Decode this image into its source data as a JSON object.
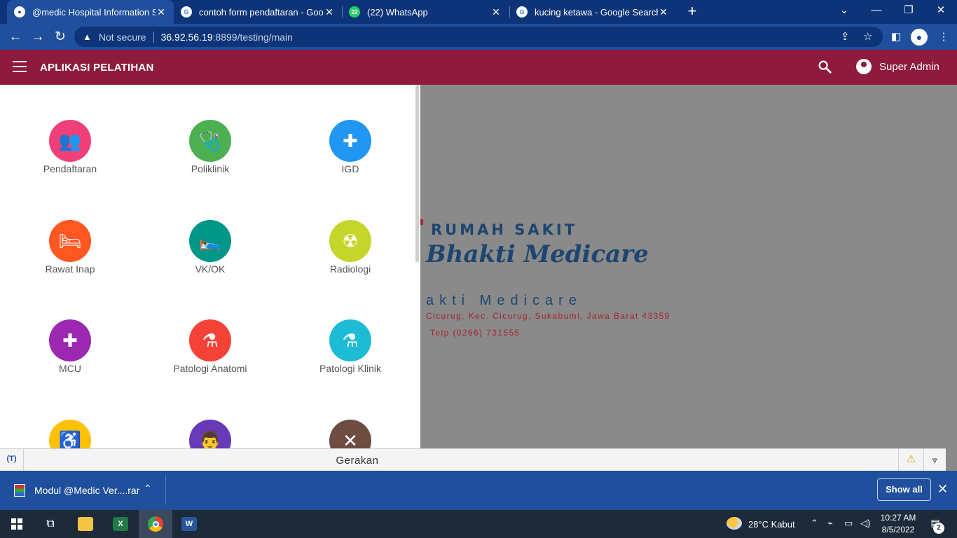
{
  "browser": {
    "tabs": [
      {
        "title": "@medic Hospital Information Sys",
        "favicon": "globe-icon",
        "active": true
      },
      {
        "title": "contoh form pendaftaran - Goog",
        "favicon": "google-icon",
        "active": false
      },
      {
        "title": "(22) WhatsApp",
        "favicon": "whatsapp-icon",
        "badge": "22",
        "active": false
      },
      {
        "title": "kucing ketawa - Google Search",
        "favicon": "google-icon",
        "active": false
      }
    ],
    "new_tab": "+",
    "window_controls": {
      "dropdown": "⌄",
      "minimize": "—",
      "restore": "❐",
      "close": "✕"
    },
    "address": {
      "security_label": "Not secure",
      "host": "36.92.56.19",
      "path": ":8899/testing/main"
    }
  },
  "app": {
    "title": "APLIKASI PELATIHAN",
    "user_name": "Super Admin",
    "accent_color": "#8e1a3e"
  },
  "menu": [
    {
      "label": "Pendaftaran",
      "color": "#f0407a",
      "icon": "person-add-icon",
      "glyph": "👥"
    },
    {
      "label": "Poliklinik",
      "color": "#4caf50",
      "icon": "stethoscope-icon",
      "glyph": "🩺"
    },
    {
      "label": "IGD",
      "color": "#2196f3",
      "icon": "medical-kit-icon",
      "glyph": "✚"
    },
    {
      "label": "Rawat Inap",
      "color": "#ff5722",
      "icon": "bed-icon",
      "glyph": "🛏"
    },
    {
      "label": "VK/OK",
      "color": "#009688",
      "icon": "patient-icon",
      "glyph": "🛌"
    },
    {
      "label": "Radiologi",
      "color": "#c6d52b",
      "icon": "radiation-icon",
      "glyph": "☢"
    },
    {
      "label": "MCU",
      "color": "#9c27b0",
      "icon": "briefcase-medical-icon",
      "glyph": "✚"
    },
    {
      "label": "Patologi Anatomi",
      "color": "#f44336",
      "icon": "flask-icon",
      "glyph": "⚗"
    },
    {
      "label": "Patologi Klinik",
      "color": "#1ebcd4",
      "icon": "flask-icon",
      "glyph": "⚗"
    },
    {
      "label": "",
      "color": "#ffc107",
      "icon": "wheelchair-icon",
      "glyph": "♿"
    },
    {
      "label": "",
      "color": "#673ab7",
      "icon": "doctor-icon",
      "glyph": "👨"
    },
    {
      "label": "",
      "color": "#6d4c41",
      "icon": "utensils-icon",
      "glyph": "✕"
    }
  ],
  "hospital": {
    "label": "RUMAH SAKIT",
    "name": "Bhakti Medicare",
    "subtitle": "akti Medicare",
    "address": "Cicurug, Kec. Cicurug, Sukabumi, Jawa Barat 43359",
    "phone": "Telp (0266) 731555"
  },
  "status_bar": {
    "text": "Gerakan"
  },
  "downloads": {
    "file_name": "Modul @Medic Ver....rar",
    "show_all": "Show all"
  },
  "taskbar": {
    "weather": "28°C  Kabut",
    "time": "10:27 AM",
    "date": "8/5/2022",
    "notifications": "2"
  }
}
